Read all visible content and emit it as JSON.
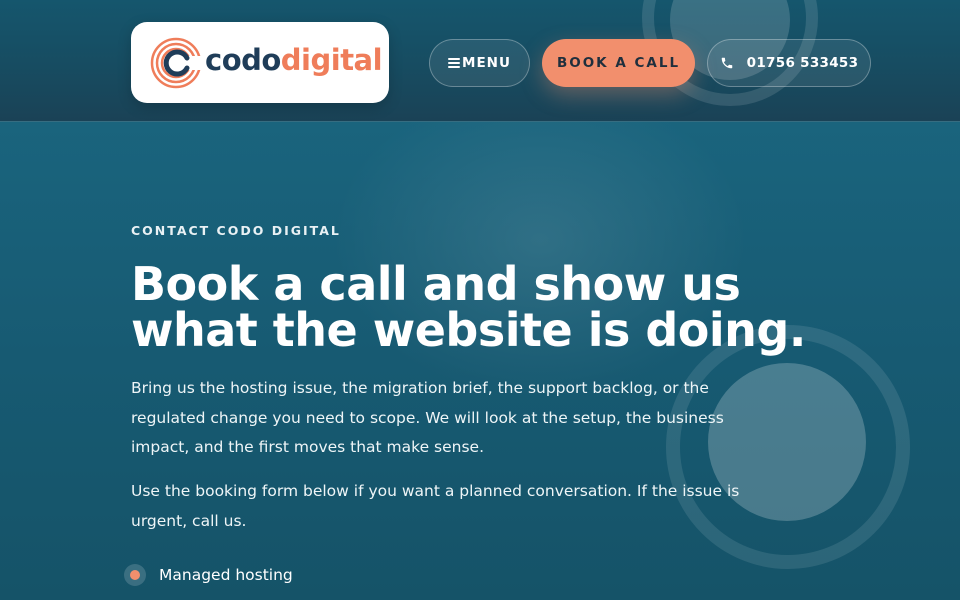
{
  "brand": {
    "name_part_1": "codo",
    "name_part_2": "digital",
    "colors": {
      "navy": "#1f3d59",
      "coral": "#ef7d5a",
      "accent": "#f28f6d",
      "teal": "#1b6983"
    }
  },
  "header": {
    "menu_label": "MENU",
    "menu_icon": "hamburger-icon",
    "book_label": "BOOK A CALL",
    "phone_icon": "phone-icon",
    "phone_number": "01756 533453"
  },
  "hero": {
    "eyebrow": "CONTACT CODO DIGITAL",
    "title_line_1": "Book a call and show us",
    "title_line_2": "what the website is doing.",
    "paragraph_1": "Bring us the hosting issue, the migration brief, the support backlog, or the regulated change you need to scope. We will look at the setup, the business impact, and the first moves that make sense.",
    "paragraph_2": "Use the booking form below if you want a planned conversation. If the issue is urgent, call us.",
    "features": [
      {
        "label": "Managed hosting"
      }
    ]
  }
}
